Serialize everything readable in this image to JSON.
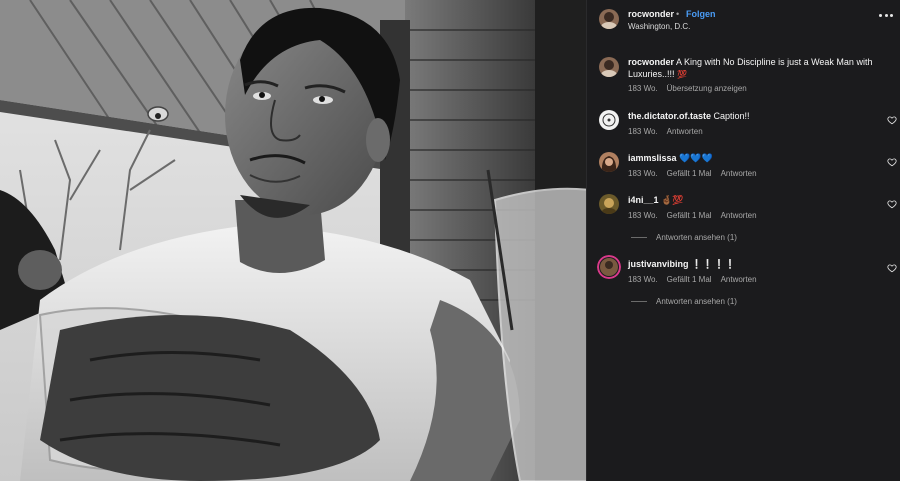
{
  "post": {
    "username": "rocwonder",
    "separator": "•",
    "follow_label": "Folgen",
    "location": "Washington, D.C.",
    "caption_text": "A King with No Discipline is just a Weak Man with Luxuries..!!!",
    "caption_emoji": "💯",
    "caption_time": "183 Wo.",
    "translate_label": "Übersetzung anzeigen"
  },
  "comments": [
    {
      "username": "the.dictator.of.taste",
      "text": "Caption!!",
      "time": "183 Wo.",
      "likes": "",
      "reply_label": "Antworten",
      "view_replies": ""
    },
    {
      "username": "iammslissa",
      "text": "💙💙💙",
      "time": "183 Wo.",
      "likes": "Gefällt 1 Mal",
      "reply_label": "Antworten",
      "view_replies": ""
    },
    {
      "username": "i4ni__1",
      "text": "🤞🏾💯",
      "time": "183 Wo.",
      "likes": "Gefällt 1 Mal",
      "reply_label": "Antworten",
      "view_replies": "Antworten ansehen (1)"
    },
    {
      "username": "justivanvibing",
      "text": "❕❕❕❕",
      "time": "183 Wo.",
      "likes": "Gefällt 1 Mal",
      "reply_label": "Antworten",
      "view_replies": "Antworten ansehen (1)"
    }
  ],
  "icons": {
    "more": "more-options-icon",
    "like": "heart-outline-icon"
  },
  "colors": {
    "panel_bg": "#1b1b1d",
    "follow_blue": "#4a9cf6",
    "muted_text": "#a8a8a8"
  }
}
